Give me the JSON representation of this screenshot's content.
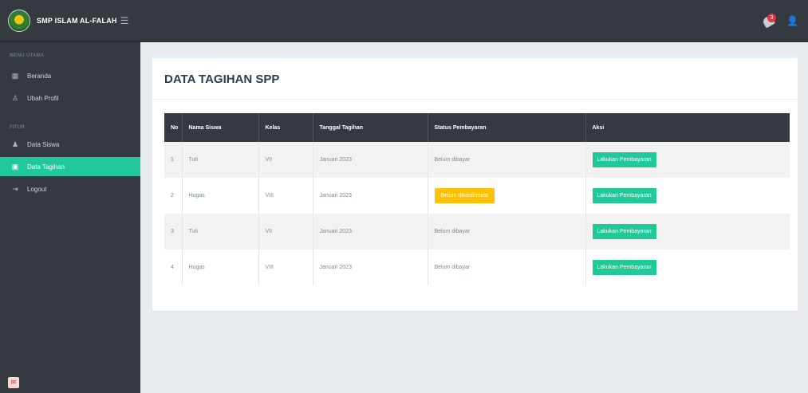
{
  "header": {
    "brand": "SMP ISLAM AL-FALAH",
    "notification_count": "3"
  },
  "sidebar": {
    "section1": "MENU UTAMA",
    "section2": "FITUR",
    "items": [
      {
        "label": "Beranda",
        "icon": "dashboard-icon"
      },
      {
        "label": "Ubah Profil",
        "icon": "user-icon"
      },
      {
        "label": "Data Siswa",
        "icon": "users-icon"
      },
      {
        "label": "Data Tagihan",
        "icon": "calendar-icon"
      },
      {
        "label": "Logout",
        "icon": "logout-icon"
      }
    ],
    "active_item": "Data Tagihan"
  },
  "main": {
    "title": "DATA TAGIHAN SPP",
    "table": {
      "columns": [
        "No",
        "Nama Siswa",
        "Kelas",
        "Tanggal Tagihan",
        "Status Pembayaran",
        "Aksi"
      ],
      "rows": [
        {
          "no": "1",
          "nama": "Tuti",
          "kelas": "VII",
          "tanggal": "Januari 2023",
          "status": "Belum dibayar",
          "status_type": "text",
          "aksi": "Lakukan Pembayaran"
        },
        {
          "no": "2",
          "nama": "Hugas",
          "kelas": "VIII",
          "tanggal": "Januari 2023",
          "status": "Belum dikonfirmasi",
          "status_type": "badge",
          "aksi": "Lakukan Pembayaran"
        },
        {
          "no": "3",
          "nama": "Tuti",
          "kelas": "VII",
          "tanggal": "Januari 2023",
          "status": "Belum dibayar",
          "status_type": "text",
          "aksi": "Lakukan Pembayaran"
        },
        {
          "no": "4",
          "nama": "Hugas",
          "kelas": "VIII",
          "tanggal": "Januari 2023",
          "status": "Belum dibayar",
          "status_type": "text",
          "aksi": "Lakukan Pembayaran"
        }
      ]
    }
  },
  "colors": {
    "sidebar_bg": "#343a40",
    "accent": "#20c997",
    "warning": "#ffc107",
    "badge": "#dc3545"
  }
}
